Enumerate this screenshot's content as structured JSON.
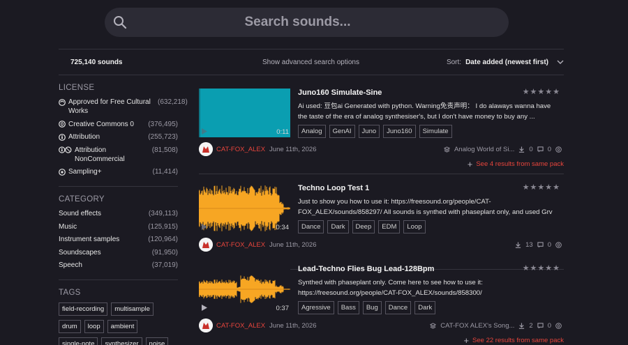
{
  "search": {
    "placeholder": "Search sounds..."
  },
  "toolbar": {
    "count": "725,140 sounds",
    "advanced": "Show advanced search options",
    "sort_label": "Sort:",
    "sort_value": "Date added (newest first)"
  },
  "sidebar": {
    "license": {
      "title": "LICENSE",
      "items": [
        {
          "label": "Approved for Free Cultural Works",
          "count": "(632,218)",
          "icon": "cc-free-icon"
        },
        {
          "label": "Creative Commons 0",
          "count": "(376,495)",
          "icon": "cc-zero-icon"
        },
        {
          "label": "Attribution",
          "count": "(255,723)",
          "icon": "cc-by-icon"
        },
        {
          "label": "Attribution NonCommercial",
          "count": "(81,508)",
          "icon": "cc-by-nc-icon"
        },
        {
          "label": "Sampling+",
          "count": "(11,414)",
          "icon": "cc-sampling-icon"
        }
      ]
    },
    "category": {
      "title": "CATEGORY",
      "items": [
        {
          "label": "Sound effects",
          "count": "(349,113)"
        },
        {
          "label": "Music",
          "count": "(125,915)"
        },
        {
          "label": "Instrument samples",
          "count": "(120,964)"
        },
        {
          "label": "Soundscapes",
          "count": "(91,950)"
        },
        {
          "label": "Speech",
          "count": "(37,019)"
        }
      ]
    },
    "tags": {
      "title": "TAGS",
      "items": [
        "field-recording",
        "multisample",
        "drum",
        "loop",
        "ambient",
        "single-note",
        "synthesizer",
        "noise"
      ]
    }
  },
  "results": [
    {
      "title": "Juno160 Simulate-Sine",
      "description": "Ai used: 豆包ai Generated with python. Warning免责声明：  I do alaways wanna have the taste of the era of analog synthesiser's, but I don't have money to buy any ...",
      "tags": [
        "Analog",
        "GenAI",
        "Juno",
        "Juno160",
        "Simulate"
      ],
      "duration": "0:11",
      "author": "CAT-FOX_ALEX",
      "date": "June 11th, 2026",
      "pack": "Analog World of Si...",
      "downloads": "0",
      "comments": "0",
      "pack_link": "See 4 results from same pack",
      "stars": "★★★★★",
      "waveform": "cyan"
    },
    {
      "title": "Techno Loop Test 1",
      "description": "Just to show you how to use it: https://freesound.org/people/CAT-FOX_ALEX/sounds/858297/ All sounds is synthed with phaseplant only, and used Grv kick",
      "tags": [
        "Dance",
        "Dark",
        "Deep",
        "EDM",
        "Loop"
      ],
      "duration": "0:34",
      "author": "CAT-FOX_ALEX",
      "date": "June 11th, 2026",
      "pack": "",
      "downloads": "13",
      "comments": "0",
      "pack_link": "",
      "stars": "★★★★★",
      "waveform": "orange-full"
    },
    {
      "title": "Lead-Techno Flies Bug Lead-128Bpm",
      "description": "Synthed with phaseplant only. Come here to see how to use it: https://freesound.org/people/CAT-FOX_ALEX/sounds/858300/",
      "tags": [
        "Agressive",
        "Bass",
        "Bug",
        "Dance",
        "Dark"
      ],
      "duration": "0:37",
      "author": "CAT-FOX_ALEX",
      "date": "June 11th, 2026",
      "pack": "CAT-FOX ALEX's Song...",
      "downloads": "2",
      "comments": "0",
      "pack_link": "See 22 results from same pack",
      "stars": "★★★★★",
      "waveform": "orange-split"
    }
  ],
  "colors": {
    "accent": "#e8453c",
    "background": "#1b1a22",
    "wave_cyan": "#0a9eb1",
    "wave_orange": "#f7a623"
  }
}
